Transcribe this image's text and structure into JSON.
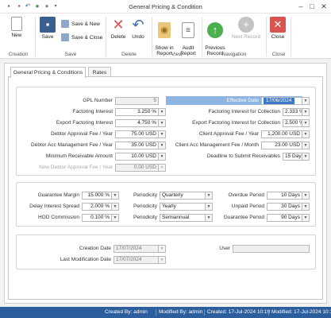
{
  "window": {
    "title": "General Pricing & Condition"
  },
  "ribbon": {
    "new": "New",
    "save": "Save",
    "save_new": "Save & New",
    "save_close": "Save & Close",
    "delete": "Delete",
    "undo": "Undo",
    "show_in_report": "Show in\nReport",
    "audit_report": "Audit\nReport",
    "previous_record": "Previous\nRecord",
    "next_record": "Next Record",
    "close": "Close",
    "groups": {
      "creation": "Creation",
      "save": "Save",
      "delete": "Delete",
      "view": "View",
      "navigation": "Navigation",
      "close": "Close"
    }
  },
  "tabs": [
    "General Pricing & Conditions",
    "Rates"
  ],
  "form": {
    "gpl_number": {
      "label": "GPL Number",
      "value": "5"
    },
    "effective_date": {
      "label": "Effective Date",
      "value": "17/06/2024"
    },
    "factoring_interest": {
      "label": "Factoring Interest",
      "value": "3.250 %"
    },
    "factoring_interest_collection": {
      "label": "Factoring Interest for Collection",
      "value": "2.333 %"
    },
    "export_factoring_interest": {
      "label": "Export Factoring Interest",
      "value": "4.750 %"
    },
    "export_factoring_interest_collection": {
      "label": "Export Factoring Interest for Collection",
      "value": "2.500 %"
    },
    "debtor_approval_fee": {
      "label": "Debtor Approval Fee / Year",
      "value": "75.00 USD"
    },
    "client_approval_fee": {
      "label": "Client Approval Fee / Year",
      "value": "1,200.00 USD"
    },
    "debtor_acc_mgmt_fee": {
      "label": "Debtor Acc Management Fee / Year",
      "value": "35.00 USD"
    },
    "client_acc_mgmt_fee": {
      "label": "Client Acc Management Fee / Month",
      "value": "23.00 USD"
    },
    "min_receivable": {
      "label": "Minimum Receivable Amount",
      "value": "10.00 USD"
    },
    "deadline_receivables": {
      "label": "Deadline to Submit Receivables",
      "value": "15 Days"
    },
    "new_debtor_approval_fee": {
      "label": "New Debtor Approval Fee / Year",
      "value": "0.00 USD"
    }
  },
  "terms": {
    "guarantee_margin": {
      "label": "Guarantee Margin",
      "value": "15.000 %"
    },
    "delay_interest_spread": {
      "label": "Delay Interest Spread",
      "value": "2.000 %"
    },
    "hod_commission": {
      "label": "HOD Commission",
      "value": "0.100 %"
    },
    "periodicity_label": "Periodicity",
    "periodicity": [
      "Quarterly",
      "Yearly",
      "Semiannual"
    ],
    "overdue_period": {
      "label": "Overdue Period",
      "value": "10 Days"
    },
    "unpaid_period": {
      "label": "Unpaid Period",
      "value": "30 Days"
    },
    "guarantee_period": {
      "label": "Guarantee Period",
      "value": "90 Days"
    }
  },
  "audit": {
    "creation_date": {
      "label": "Creation Date",
      "value": "17/07/2024"
    },
    "last_modification_date": {
      "label": "Last Modification Date",
      "value": "17/07/2024"
    },
    "user": {
      "label": "User",
      "value": ""
    }
  },
  "status": {
    "created_by": "Created By: admin",
    "modified_by": "Modified By: admin",
    "created": "Created: 17-Jul-2024 10:19",
    "modified": "Modified: 17-Jul-2024 10:19"
  },
  "colors": {
    "accent": "#2c5e9e",
    "delete": "#d9534f",
    "close": "#d9534f",
    "nav": "#4caf50",
    "highlight": "#8fb6e2"
  },
  "icons": [
    "save-icon",
    "save-new-icon",
    "save-close-icon",
    "delete-icon",
    "undo-icon",
    "report-icon",
    "audit-icon",
    "previous-icon",
    "next-icon",
    "close-icon",
    "dropdown-icon"
  ]
}
